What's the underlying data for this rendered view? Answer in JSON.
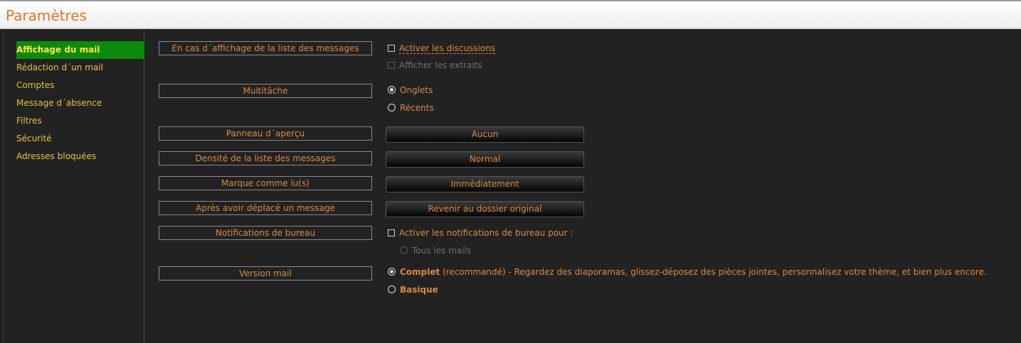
{
  "window": {
    "title": "Paramètres"
  },
  "sidebar": {
    "items": [
      {
        "label": "Affichage du mail",
        "active": true
      },
      {
        "label": "Rédaction d´un mail"
      },
      {
        "label": "Comptes"
      },
      {
        "label": "Message d´absence"
      },
      {
        "label": "Filtres"
      },
      {
        "label": "Sécurité"
      },
      {
        "label": "Adresses bloquées"
      }
    ]
  },
  "settings": {
    "message_list": {
      "label": "En cas d´affichage de la liste des messages",
      "enable_discussions": "Activer les discussions",
      "show_excerpts": "Afficher les extraits"
    },
    "multitask": {
      "label": "Multitâche",
      "tabs": "Onglets",
      "recent": "Récents"
    },
    "preview_pane": {
      "label": "Panneau d´aperçu",
      "value": "Aucun"
    },
    "list_density": {
      "label": "Densité de la liste des messages",
      "value": "Normal"
    },
    "mark_read": {
      "label": "Marque comme lu(s)",
      "value": "Immédiatement"
    },
    "after_move": {
      "label": "Après avoir déplacé un message",
      "value": "Revenir au dossier original"
    },
    "desktop_notifications": {
      "label": "Notifications de bureau",
      "enable": "Activer les notifications de bureau pour :",
      "all_mails": "Tous les mails"
    },
    "mail_version": {
      "label": "Version mail",
      "full_bold": "Complet",
      "full_rest": " (recommandé) - Regardez des diaporamas, glissez-déposez des pièces jointes, personnalisez votre thème, et bien plus encore.",
      "basic": "Basique"
    }
  },
  "colors": {
    "accent": "#d98a45",
    "active_bg": "#0b8a0b",
    "sidebar_text": "#e7c23e",
    "background": "#222222"
  }
}
